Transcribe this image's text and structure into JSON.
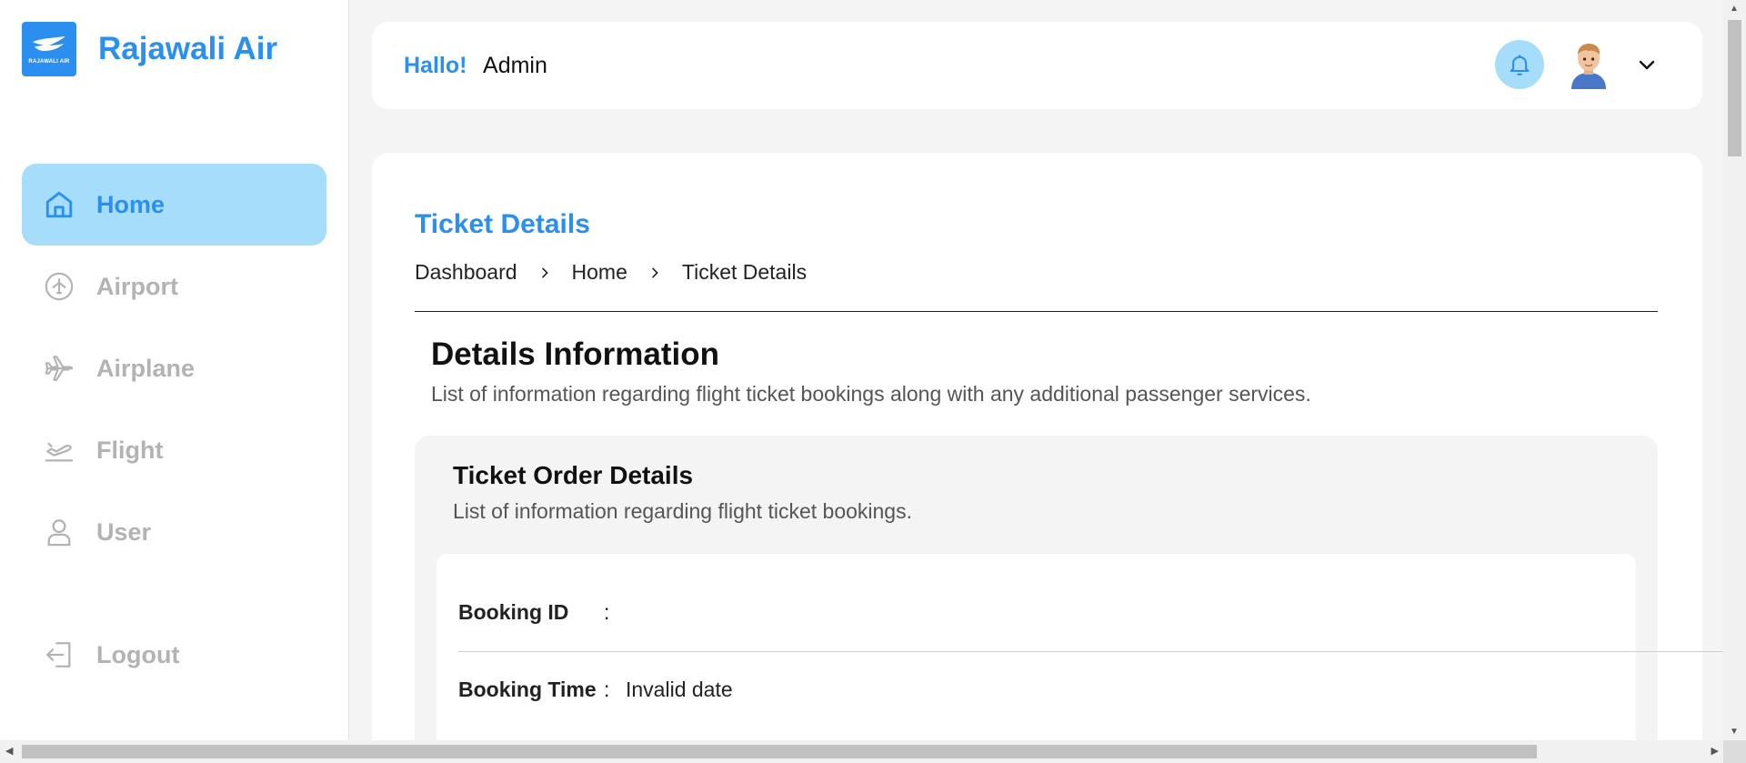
{
  "brand": {
    "name": "Rajawali Air",
    "logo_text": "RAJAWALI AIR"
  },
  "sidebar": {
    "items": [
      {
        "label": "Home",
        "icon": "home-icon",
        "active": true
      },
      {
        "label": "Airport",
        "icon": "airport-icon",
        "active": false
      },
      {
        "label": "Airplane",
        "icon": "airplane-icon",
        "active": false
      },
      {
        "label": "Flight",
        "icon": "flight-departure-icon",
        "active": false
      },
      {
        "label": "User",
        "icon": "user-icon",
        "active": false
      }
    ],
    "logout_label": "Logout"
  },
  "header": {
    "greeting": "Hallo!",
    "user_name": "Admin"
  },
  "page": {
    "title": "Ticket Details",
    "breadcrumb": [
      "Dashboard",
      "Home",
      "Ticket Details"
    ]
  },
  "details": {
    "title": "Details Information",
    "subtitle": "List of information regarding flight ticket bookings along with any additional passenger services."
  },
  "order": {
    "title": "Ticket Order Details",
    "subtitle": "List of information regarding flight ticket bookings.",
    "rows": [
      {
        "label": "Booking ID",
        "value": ""
      },
      {
        "label": "Booking Time",
        "value": "Invalid date"
      }
    ]
  },
  "colors": {
    "accent": "#2b8ff0",
    "accent_light": "#a6ddfb",
    "muted": "#b3b3b3"
  }
}
